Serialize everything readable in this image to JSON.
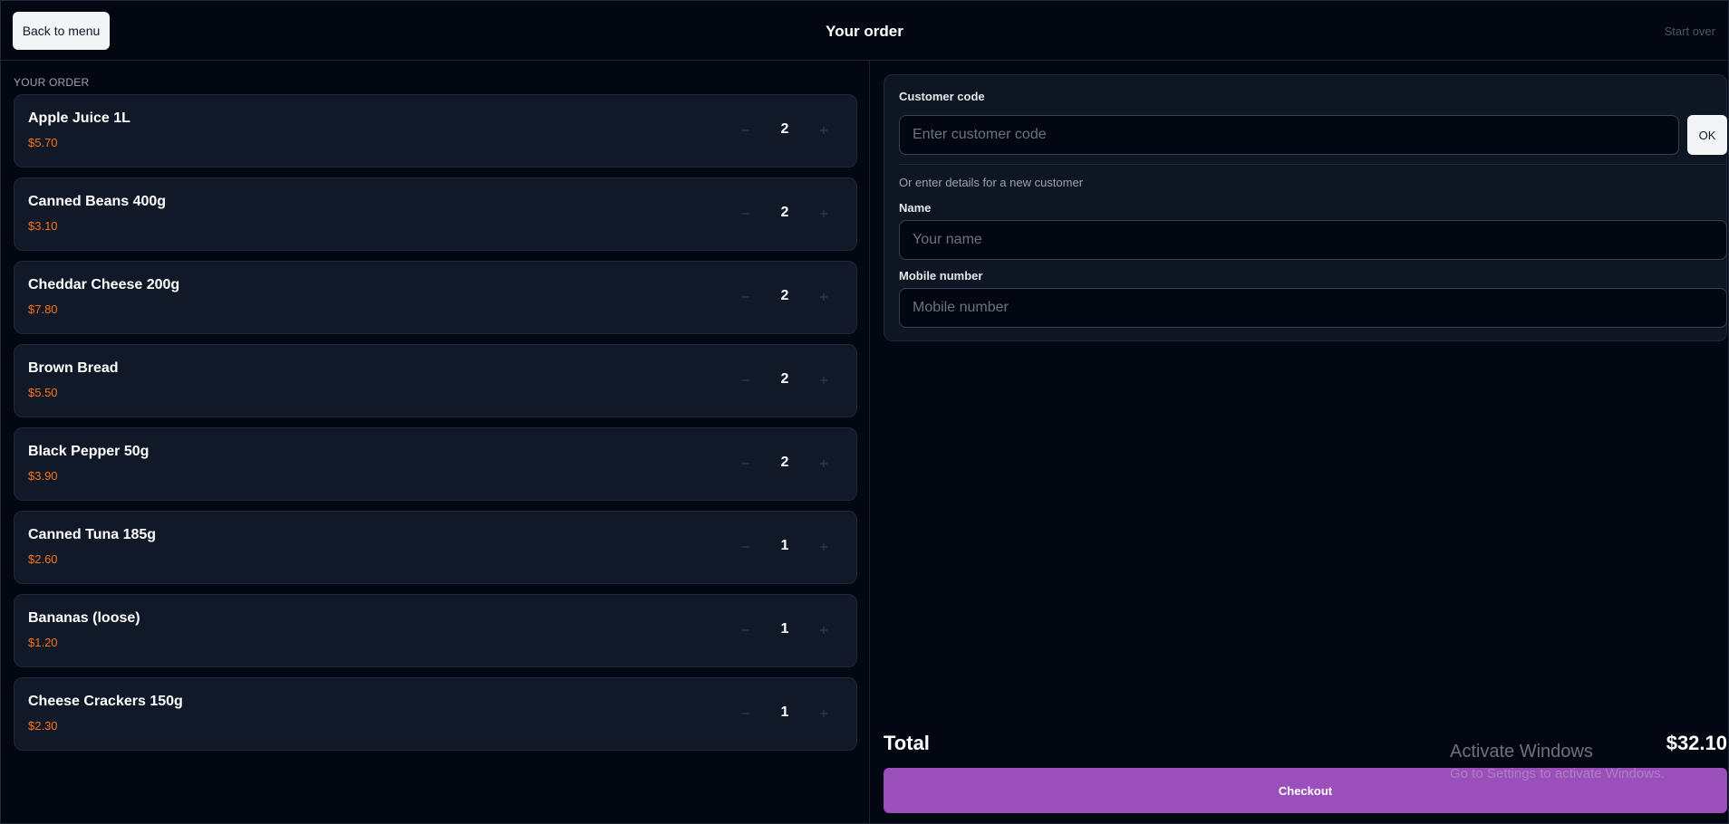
{
  "header": {
    "back_label": "Back to menu",
    "title": "Your order",
    "start_over_label": "Start over"
  },
  "order": {
    "section_label": "YOUR ORDER",
    "items": [
      {
        "name": "Apple Juice 1L",
        "price": "$5.70",
        "qty": "2"
      },
      {
        "name": "Canned Beans 400g",
        "price": "$3.10",
        "qty": "2"
      },
      {
        "name": "Cheddar Cheese 200g",
        "price": "$7.80",
        "qty": "2"
      },
      {
        "name": "Brown Bread",
        "price": "$5.50",
        "qty": "2"
      },
      {
        "name": "Black Pepper 50g",
        "price": "$3.90",
        "qty": "2"
      },
      {
        "name": "Canned Tuna 185g",
        "price": "$2.60",
        "qty": "1"
      },
      {
        "name": "Bananas (loose)",
        "price": "$1.20",
        "qty": "1"
      },
      {
        "name": "Cheese Crackers 150g",
        "price": "$2.30",
        "qty": "1"
      }
    ],
    "minus_glyph": "−",
    "plus_glyph": "+"
  },
  "customer": {
    "code_label": "Customer code",
    "code_placeholder": "Enter customer code",
    "ok_label": "OK",
    "hint": "Or enter details for a new customer",
    "name_label": "Name",
    "name_placeholder": "Your name",
    "mobile_label": "Mobile number",
    "mobile_placeholder": "Mobile number"
  },
  "summary": {
    "total_label": "Total",
    "total_value": "$32.10",
    "checkout_label": "Checkout"
  },
  "watermark": {
    "title": "Activate Windows",
    "subtitle": "Go to Settings to activate Windows."
  },
  "colors": {
    "background": "#030712",
    "card": "#111827",
    "price": "#f97316",
    "checkout": "#9b4fbb"
  }
}
